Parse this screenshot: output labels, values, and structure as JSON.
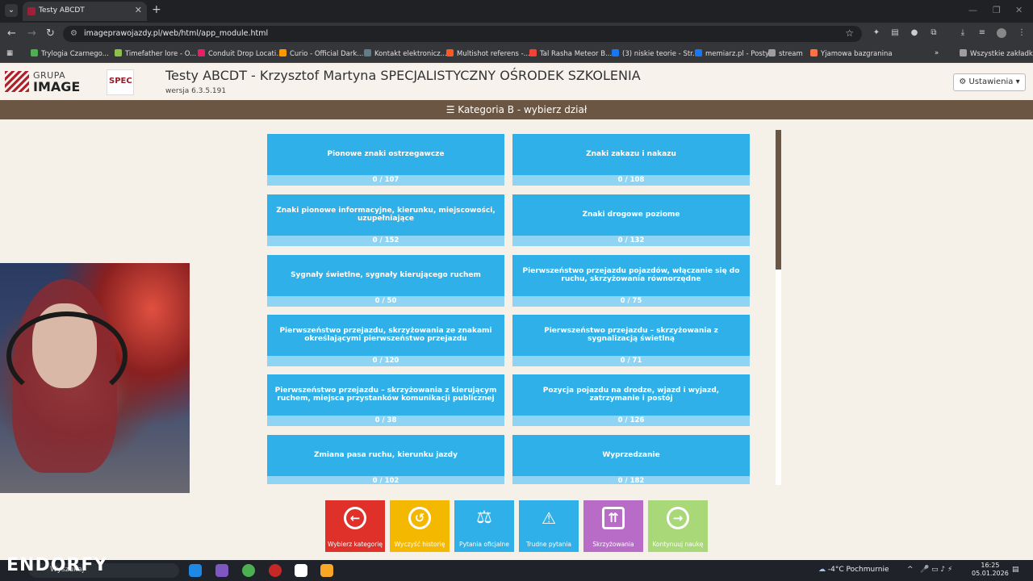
{
  "browser": {
    "tab_title": "Testy ABCDT",
    "url": "imageprawojazdy.pl/web/html/app_module.html",
    "bookmarks": [
      {
        "label": "Trylogia Czarnego...",
        "color": "#4caf50"
      },
      {
        "label": "Timefather lore - O...",
        "color": "#8bc34a"
      },
      {
        "label": "Conduit Drop Locati...",
        "color": "#e91e63"
      },
      {
        "label": "Curio - Official Dark...",
        "color": "#ff9800"
      },
      {
        "label": "Kontakt elektronicz...",
        "color": "#607d8b"
      },
      {
        "label": "Multishot referens -...",
        "color": "#ff5722"
      },
      {
        "label": "Tal Rasha Meteor B...",
        "color": "#f44336"
      },
      {
        "label": "(3) niskie teorie - Str...",
        "color": "#1877f2"
      },
      {
        "label": "memiarz.pl - Posty",
        "color": "#1877f2"
      },
      {
        "label": "stream",
        "color": "#9e9e9e"
      },
      {
        "label": "Yjamowa bazgranina",
        "color": "#ff7043"
      }
    ],
    "all_bookmarks": "Wszystkie zakładki"
  },
  "header": {
    "logo_line1": "GRUPA",
    "logo_line2": "IMAGE",
    "spec_logo": "SPEC",
    "title": "Testy ABCDT - Krzysztof Martyna SPECJALISTYCZNY OŚRODEK SZKOLENIA",
    "version": "wersja 6.3.5.191",
    "settings": "Ustawienia"
  },
  "category_bar": "Kategoria B - wybierz dział",
  "sections": [
    {
      "label": "Pionowe znaki ostrzegawcze",
      "progress": "0 / 107"
    },
    {
      "label": "Znaki zakazu i nakazu",
      "progress": "0 / 108"
    },
    {
      "label": "Znaki pionowe informacyjne, kierunku, miejscowości, uzupełniające",
      "progress": "0 / 152"
    },
    {
      "label": "Znaki drogowe poziome",
      "progress": "0 / 132"
    },
    {
      "label": "Sygnały świetlne, sygnały kierującego ruchem",
      "progress": "0 / 50"
    },
    {
      "label": "Pierwszeństwo przejazdu pojazdów, włączanie się do ruchu, skrzyżowania równorzędne",
      "progress": "0 / 75"
    },
    {
      "label": "Pierwszeństwo przejazdu, skrzyżowania ze znakami określającymi pierwszeństwo przejazdu",
      "progress": "0 / 120"
    },
    {
      "label": "Pierwszeństwo przejazdu – skrzyżowania z sygnalizacją świetlną",
      "progress": "0 / 71"
    },
    {
      "label": "Pierwszeństwo przejazdu – skrzyżowania z kierującym ruchem, miejsca przystanków komunikacji publicznej",
      "progress": "0 / 38"
    },
    {
      "label": "Pozycja pojazdu na drodze, wjazd i wyjazd, zatrzymanie i postój",
      "progress": "0 / 126"
    },
    {
      "label": "Zmiana pasa ruchu, kierunku jazdy",
      "progress": "0 / 102"
    },
    {
      "label": "Wyprzedzanie",
      "progress": "0 / 182"
    }
  ],
  "actions": [
    {
      "label": "Wybierz kategorię",
      "icon": "arrow-left-circle-icon",
      "glyph": "←",
      "color": "#e0302a"
    },
    {
      "label": "Wyczyść historię",
      "icon": "history-icon",
      "glyph": "↺",
      "color": "#f5b800"
    },
    {
      "label": "Pytania oficjalne",
      "icon": "gavel-icon",
      "glyph": "⚖",
      "color": "#2fb0e8"
    },
    {
      "label": "Trudne pytania",
      "icon": "warning-icon",
      "glyph": "!",
      "color": "#2fb0e8"
    },
    {
      "label": "Skrzyżowania",
      "icon": "road-icon",
      "glyph": "⇈",
      "color": "#b86cc8"
    },
    {
      "label": "Kontynuuj naukę",
      "icon": "arrow-right-circle-icon",
      "glyph": "→",
      "color": "#a8d878"
    }
  ],
  "overlay": {
    "brand": "ENDORFY"
  },
  "taskbar": {
    "search": "Wyszukaj",
    "weather": "-4°C  Pochmurnie",
    "time": "16:25",
    "date": "05.01.2026"
  }
}
